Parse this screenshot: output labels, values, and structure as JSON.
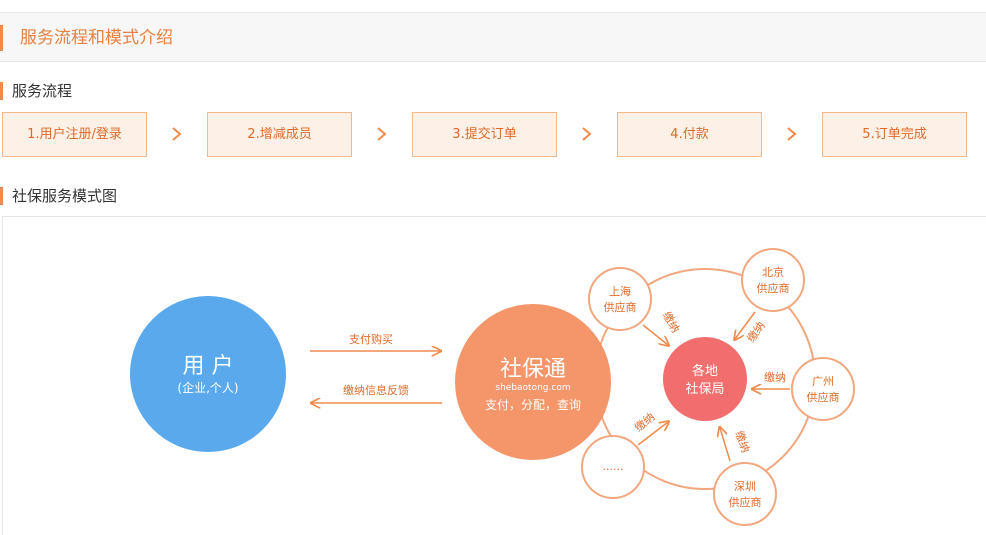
{
  "header": {
    "title": "服务流程和模式介绍"
  },
  "process": {
    "title": "服务流程",
    "steps": [
      "1.用户注册/登录",
      "2.增减成员",
      "3.提交订单",
      "4.付款",
      "5.订单完成"
    ]
  },
  "model": {
    "title": "社保服务模式图",
    "user": {
      "name": "用 户",
      "sub": "(企业,个人)"
    },
    "platform": {
      "name": "社保通",
      "domain": "shebaotong.com",
      "desc": "支付，分配，查询"
    },
    "flow_right": "支付购买",
    "flow_left": "缴纳信息反馈",
    "bureau": {
      "line1": "各地",
      "line2": "社保局"
    },
    "suppliers": [
      {
        "line1": "上海",
        "line2": "供应商"
      },
      {
        "line1": "北京",
        "line2": "供应商"
      },
      {
        "line1": "广州",
        "line2": "供应商"
      },
      {
        "line1": "深圳",
        "line2": "供应商"
      },
      {
        "line1": "......",
        "line2": ""
      }
    ],
    "pay_label": "缴纳"
  },
  "colors": {
    "accent": "#f08a4b",
    "user_circle": "#5aa9ec",
    "platform_circle": "#f5956a",
    "bureau_circle": "#f26d6d",
    "step_bg": "#fdf1e7",
    "step_text": "#e06a2a"
  }
}
